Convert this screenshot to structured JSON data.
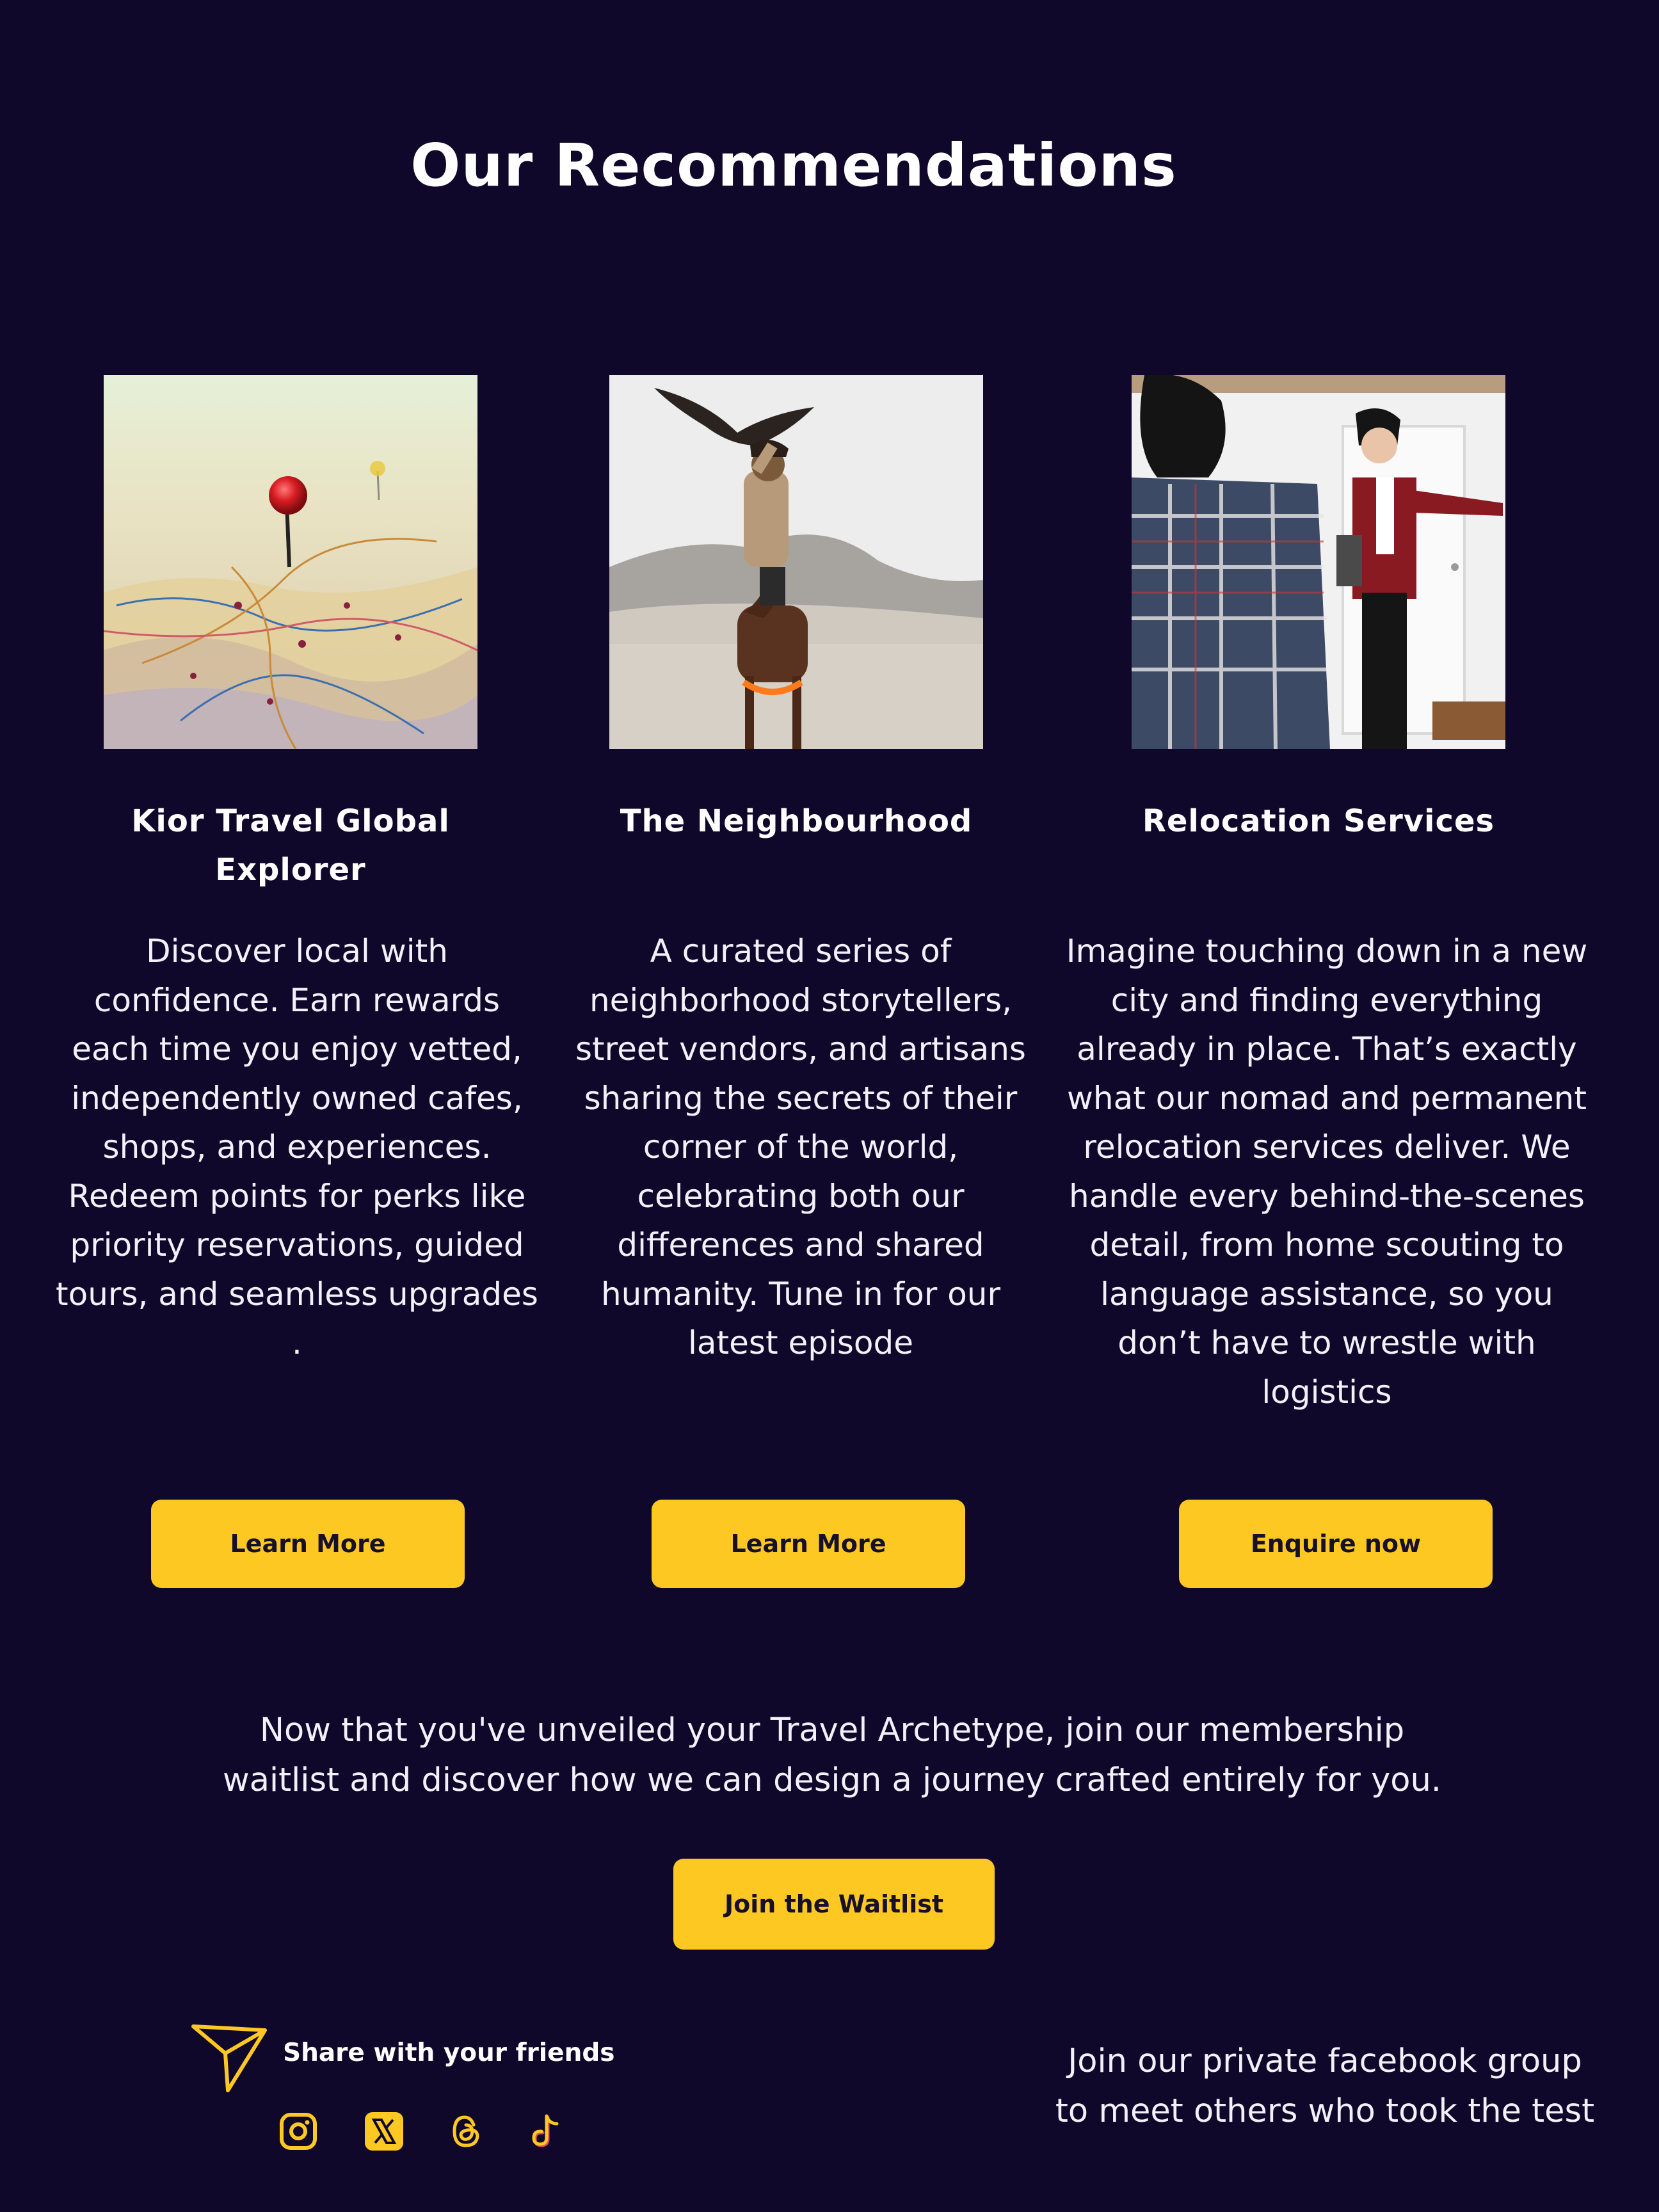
{
  "page": {
    "title": "Our Recommendations",
    "background_color": "#10082b",
    "accent_color": "#fec823"
  },
  "cards": [
    {
      "image": "map-pin-photo",
      "title_line1": "Kior Travel Global",
      "title_line2": "Explorer",
      "description": "Discover local with confidence. Earn rewards each time you enjoy vetted, independently owned cafes, shops, and experiences. Redeem points for perks like priority reservations, guided tours, and seamless upgrades .",
      "button_label": "Learn More"
    },
    {
      "image": "eagle-hunter-on-horse-photo",
      "title_line1": "The Neighbourhood",
      "title_line2": "",
      "description": "A curated series of neighborhood storytellers, street vendors, and artisans sharing the secrets of their corner of the world, celebrating both our differences and shared humanity. Tune in for our latest episode",
      "button_label": "Learn More"
    },
    {
      "image": "apartment-viewing-photo",
      "title_line1": "Relocation Services",
      "title_line2": "",
      "description": "Imagine touching down in a new city and finding everything already in place. That’s exactly what our nomad and permanent relocation services deliver. We handle every behind-the-scenes detail, from home scouting to language assistance, so you don’t have to wrestle with logistics",
      "button_label": "Enquire now"
    }
  ],
  "cta": {
    "text_line1": "Now that you've unveiled your Travel Archetype, join our membership",
    "text_line2": "waitlist and discover how we can design a journey crafted entirely for you.",
    "button_label": "Join the Waitlist"
  },
  "share": {
    "icon": "paper-plane-icon",
    "label": "Share with your friends",
    "socials": [
      "instagram-icon",
      "x-icon",
      "threads-icon",
      "tiktok-icon"
    ]
  },
  "facebook": {
    "line1": "Join our private facebook group",
    "line2": "to meet others who took the test"
  }
}
